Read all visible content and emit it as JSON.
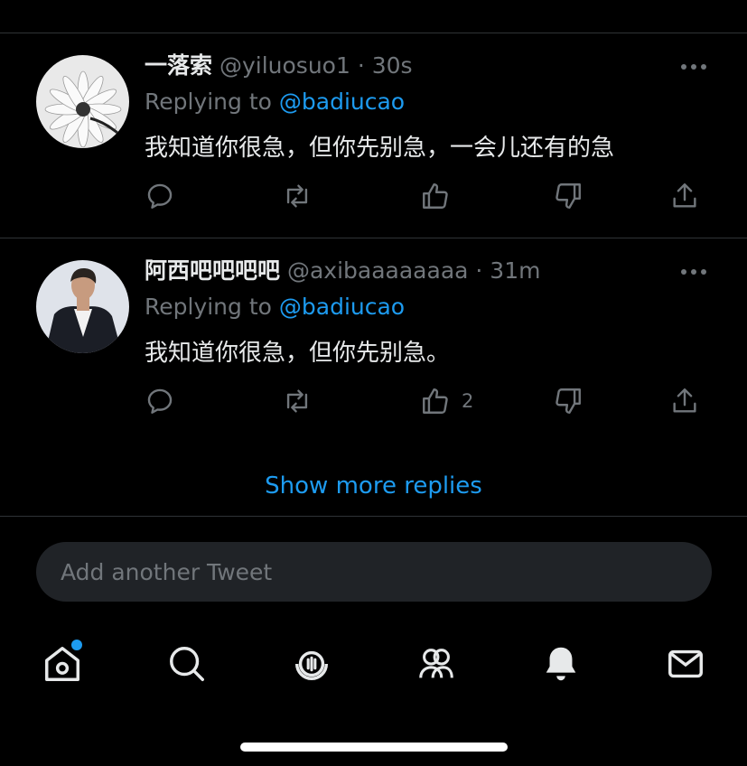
{
  "tweets": [
    {
      "name": "一落索",
      "handle": "@yiluosuo1 · 30s",
      "replying_prefix": "Replying to ",
      "replying_to": "@badiucao",
      "text": "我知道你很急，但你先别急，一会儿还有的急",
      "like_count": ""
    },
    {
      "name": "阿西吧吧吧吧",
      "handle": "@axibaaaaaaaa · 31m",
      "replying_prefix": "Replying to ",
      "replying_to": "@badiucao",
      "text": "我知道你很急，但你先别急。",
      "like_count": "2"
    }
  ],
  "show_more": "Show more replies",
  "compose": {
    "placeholder": "Add another Tweet"
  },
  "tabbar": [
    "home-icon",
    "search-icon",
    "spaces-icon",
    "communities-icon",
    "notifications-icon",
    "messages-icon"
  ],
  "colors": {
    "accent": "#1d9bf0",
    "muted": "#71767b",
    "background": "#000000"
  }
}
